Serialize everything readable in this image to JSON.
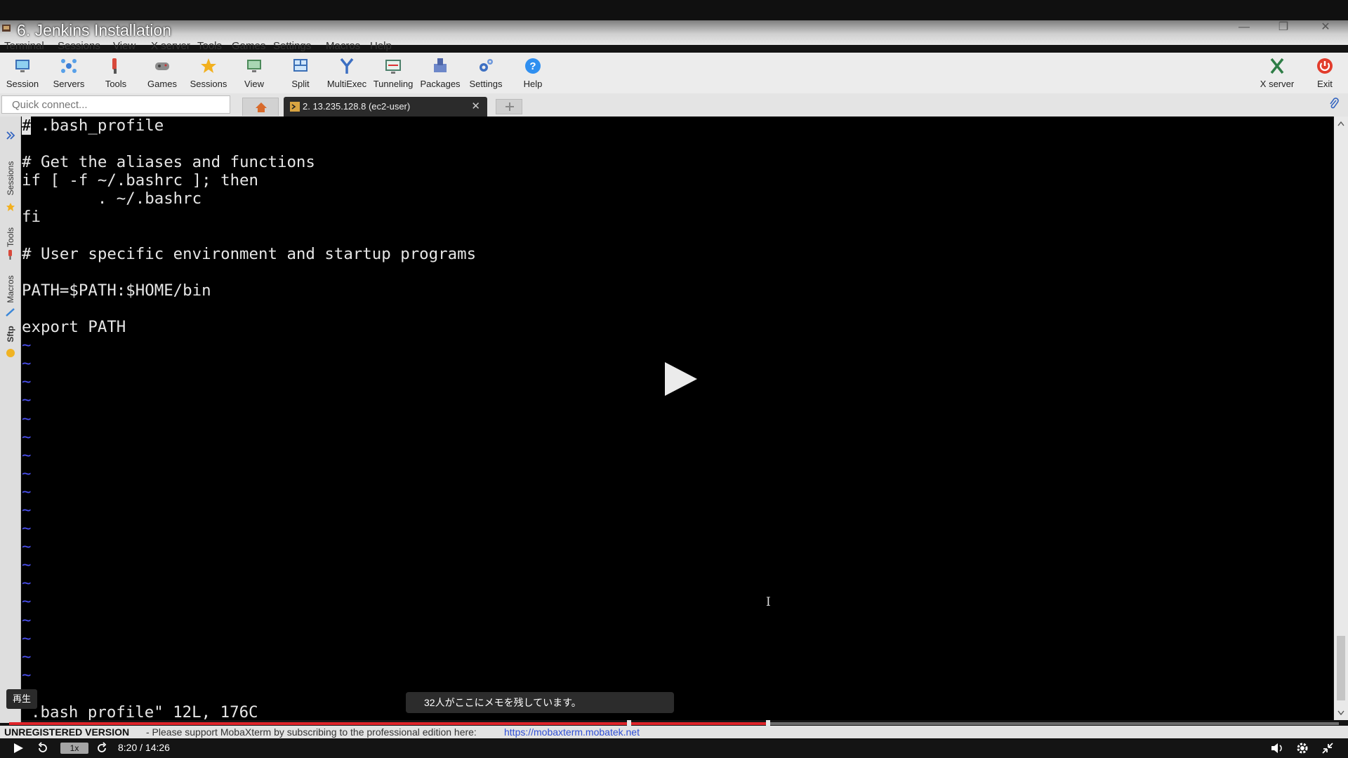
{
  "video": {
    "title": "6. Jenkins Installation",
    "play_tooltip": "再生",
    "notes_message": "32人がここにメモを残しています。",
    "speed": "1x",
    "time": "8:20 / 14:26",
    "progress_played_fraction": 0.571,
    "progress_buffered_fraction": 0.571,
    "accent_color": "#e0242a"
  },
  "menu": [
    "Terminal",
    "Sessions",
    "View",
    "X server",
    "Tools",
    "Games",
    "Settings",
    "Macros",
    "Help"
  ],
  "toolbar": {
    "session": "Session",
    "servers": "Servers",
    "tools": "Tools",
    "games": "Games",
    "sessions": "Sessions",
    "view": "View",
    "split": "Split",
    "multiexec": "MultiExec",
    "tunneling": "Tunneling",
    "packages": "Packages",
    "settings": "Settings",
    "help": "Help",
    "xserver": "X server",
    "exit": "Exit"
  },
  "quick_connect": {
    "placeholder": "Quick connect..."
  },
  "tabs": {
    "session_label": "2. 13.235.128.8 (ec2-user)"
  },
  "sidebar": {
    "sessions": "Sessions",
    "tools": "Tools",
    "macros": "Macros",
    "sftp": "Sftp"
  },
  "terminal": {
    "lines": [
      "# .bash_profile",
      "",
      "# Get the aliases and functions",
      "if [ -f ~/.bashrc ]; then",
      "        . ~/.bashrc",
      "fi",
      "",
      "# User specific environment and startup programs",
      "",
      "PATH=$PATH:$HOME/bin",
      "",
      "export PATH"
    ],
    "tilde_count": 19,
    "tilde_char": "~",
    "status": ".bash_profile\" 12L, 176C"
  },
  "statusbar": {
    "unregistered": "UNREGISTERED VERSION",
    "message": "-  Please support MobaXterm by subscribing to the professional edition here:",
    "link": "https://mobaxterm.mobatek.net"
  }
}
